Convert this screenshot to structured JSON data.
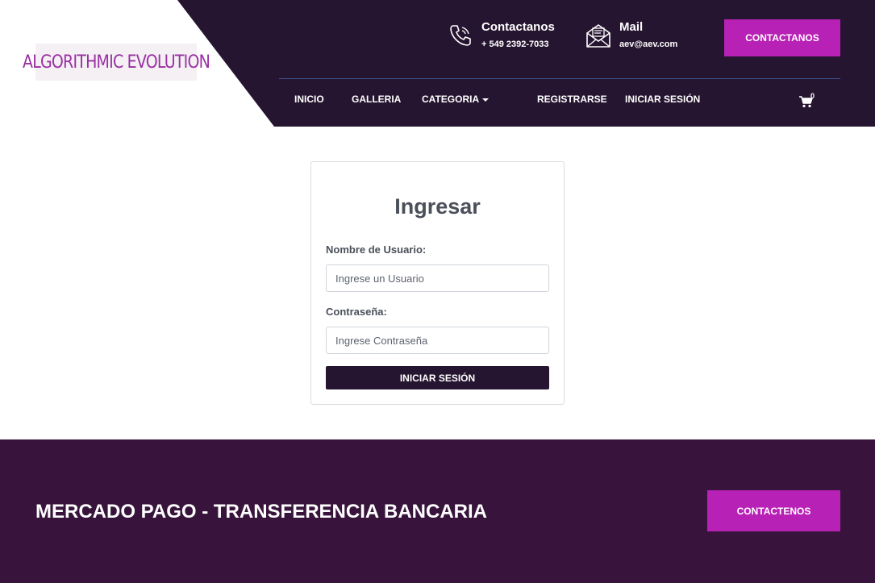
{
  "header": {
    "logo_text": "ALGORITHMIC EVOLUTION",
    "phone": {
      "title": "Contactanos",
      "value": "+ 549 2392-7033"
    },
    "mail": {
      "title": "Mail",
      "value": "aev@aev.com"
    },
    "contact_button": "CONTACTANOS",
    "nav": [
      "INICIO",
      "GALLERIA",
      "CATEGORIA",
      "REGISTRARSE",
      "INICIAR SESIÓN"
    ],
    "cart_count": "0"
  },
  "login": {
    "title": "Ingresar",
    "username_label": "Nombre de Usuario:",
    "username_placeholder": "Ingrese un Usuario",
    "password_label": "Contraseña:",
    "password_placeholder": "Ingrese Contraseña",
    "submit_label": "INICIAR SESIÓN"
  },
  "footer": {
    "title": "MERCADO PAGO - TRANSFERENCIA BANCARIA",
    "button": "CONTACTENOS"
  },
  "colors": {
    "header_dark": "#261530",
    "accent": "#b821b5",
    "footer_bg": "#38143c"
  }
}
